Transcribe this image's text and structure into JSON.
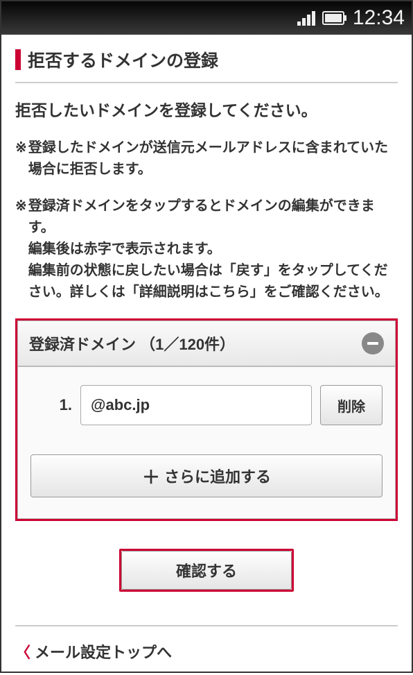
{
  "status_bar": {
    "time": "12:34"
  },
  "header": {
    "title": "拒否するドメインの登録"
  },
  "instruction": "拒否したいドメインを登録してください。",
  "notes": [
    "登録したドメインが送信元メールアドレスに含まれていた場合に拒否します。",
    "登録済ドメインをタップするとドメインの編集ができます。\n編集後は赤字で表示されます。\n編集前の状態に戻したい場合は「戻す」をタップしてください。詳しくは「詳細説明はこちら」をご確認ください。"
  ],
  "note_marker": "※",
  "panel": {
    "title": "登録済ドメイン （1／120件）",
    "rows": [
      {
        "num": "1.",
        "value": "@abc.jp"
      }
    ],
    "delete_label": "削除",
    "add_more_label": "さらに追加する"
  },
  "confirm_label": "確認する",
  "back_link_label": "メール設定トップへ"
}
